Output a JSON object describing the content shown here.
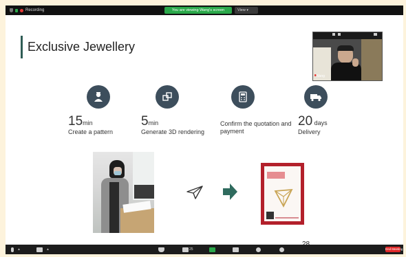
{
  "top_bar": {
    "recording_label": "Recording",
    "share_title": "You are viewing Wang's screen",
    "view_label": "View"
  },
  "slide": {
    "title": "Exclusive Jewellery",
    "steps": [
      {
        "icon": "designer-icon",
        "value": "15",
        "unit": "min",
        "caption": "Create a pattern"
      },
      {
        "icon": "3d-cube-icon",
        "value": "5",
        "unit": "min",
        "caption": "Generate 3D rendering"
      },
      {
        "icon": "calculator-icon",
        "value": "",
        "unit": "",
        "caption": "Confirm the quotation and payment"
      },
      {
        "icon": "delivery-truck-icon",
        "value": "20",
        "unit": " days",
        "caption": "Delivery"
      }
    ],
    "page_number": "28",
    "accent_color": "#2f5d55",
    "icon_circle_color": "#3d4e5c",
    "arrow_color": "#2f6b5e"
  },
  "video": {
    "participant_name": "Wang"
  },
  "toolbar": {
    "participant_count": "25",
    "end_label": "End Meeting"
  }
}
